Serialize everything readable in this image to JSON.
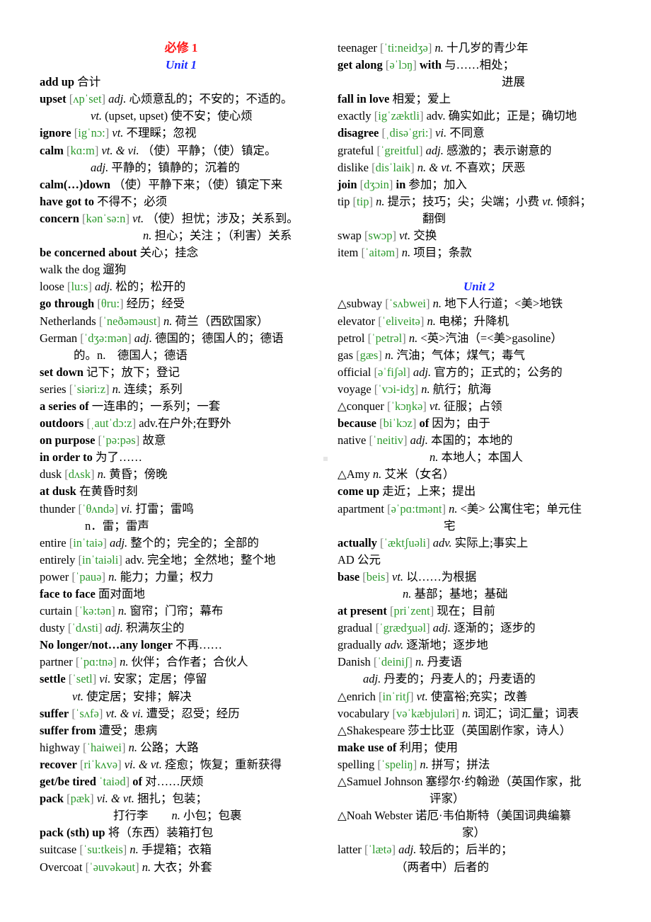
{
  "document": {
    "book_title": "必修 1",
    "units": [
      {
        "title": "Unit 1",
        "entries": [
          {
            "hw": "add up",
            "bold": true,
            "def": "合计"
          },
          {
            "hw": "upset",
            "bold": true,
            "ph": "ʌpˈset",
            "pos": "adj.",
            "def": "心烦意乱的；不安的；不适的。",
            "cont": [
              {
                "indent": 72,
                "pos": "vt.",
                "def": "(upset, upset)  使不安；使心烦"
              }
            ]
          },
          {
            "hw": "ignore",
            "bold": true,
            "ph": "igˈnɔ:",
            "pos": "vt.",
            "def": "不理睬；忽视"
          },
          {
            "hw": "calm",
            "bold": true,
            "ph": "kɑ:m",
            "pos": "vt. & vi.",
            "def": "（使）平静；（使）镇定。",
            "cont": [
              {
                "indent": 72,
                "pos": "adj.",
                "def": "平静的；镇静的；沉着的"
              }
            ]
          },
          {
            "hw": "calm(…)down",
            "bold": true,
            "def": "（使）平静下来；（使）镇定下来"
          },
          {
            "hw": "have got to",
            "bold": true,
            "def": "不得不；必须"
          },
          {
            "hw": "concern",
            "bold": true,
            "ph": "kənˈsə:n",
            "pos": "vt.",
            "def": "（使）担忧；涉及；关系到。",
            "cont": [
              {
                "indent": 146,
                "pos": "n.",
                "def": "担心；关注 ；（利害）关系"
              }
            ]
          },
          {
            "hw": "be concerned about",
            "bold": true,
            "def": "关心；挂念"
          },
          {
            "hw": "walk the dog",
            "bold": false,
            "def": "遛狗"
          },
          {
            "hw": "loose",
            "bold": false,
            "ph": "lu:s",
            "pos": "adj.",
            "def": "松的；松开的"
          },
          {
            "hw": "go through",
            "bold": true,
            "ph": "θru:",
            "def": "经历；经受"
          },
          {
            "hw": "Netherlands",
            "bold": false,
            "ph": "ˈneðəməust",
            "pos": "n.",
            "def": "荷兰（西欧国家）"
          },
          {
            "hw": "German",
            "bold": false,
            "ph": "ˈdʒə:mən",
            "pos": "adj.",
            "def": "德国的；德国人的；德语",
            "cont": [
              {
                "indent": 48,
                "pos": "",
                "def": "的。n.　德国人；德语"
              }
            ]
          },
          {
            "hw": "set down",
            "bold": true,
            "def": "记下；放下；登记"
          },
          {
            "hw": "series",
            "bold": false,
            "ph": "ˈsiəri:z",
            "pos": "n.",
            "def": "连续；系列"
          },
          {
            "hw": "a series of",
            "bold": true,
            "def": "一连串的；一系列；一套"
          },
          {
            "hw": "outdoors",
            "bold": true,
            "ph": "ˌautˈdɔ:z",
            "pos": "",
            "def": "adv.在户外;在野外"
          },
          {
            "hw": "on purpose",
            "bold": true,
            "ph": "ˈpə:pəs",
            "def": "故意"
          },
          {
            "hw": "in order to",
            "bold": true,
            "def": "为了……"
          },
          {
            "hw": "dusk",
            "bold": false,
            "ph": "dʌsk",
            "pos": "n.",
            "def": "黄昏；傍晚"
          },
          {
            "hw": "at dusk",
            "bold": true,
            "def": "在黄昏时刻"
          },
          {
            "hw": "thunder",
            "bold": false,
            "ph": "ˈθʌndə",
            "pos": "vi.",
            "def": "打雷；雷鸣",
            "cont": [
              {
                "indent": 64,
                "pos": "",
                "def": "n．雷；雷声"
              }
            ]
          },
          {
            "hw": "entire",
            "bold": false,
            "ph": "inˈtaiə",
            "pos": "adj.",
            "def": "整个的；完全的；全部的"
          },
          {
            "hw": "entirely",
            "bold": false,
            "ph": "inˈtaiəli",
            "pos": "",
            "def": "adv.  完全地；全然地；整个地"
          },
          {
            "hw": "power",
            "bold": false,
            "ph": "ˈpauə",
            "pos": "n.",
            "def": "能力；力量；权力"
          },
          {
            "hw": "face to face",
            "bold": true,
            "def": "面对面地"
          },
          {
            "hw": "curtain",
            "bold": false,
            "ph": "ˈkə:tən",
            "pos": "n.",
            "def": "窗帘；门帘；幕布"
          },
          {
            "hw": "dusty",
            "bold": false,
            "ph": "ˈdʌsti",
            "pos": "adj.",
            "def": "积满灰尘的"
          },
          {
            "hw": "No longer/not…any longer",
            "bold": true,
            "def": "不再……"
          },
          {
            "hw": "partner",
            "bold": false,
            "ph": "ˈpɑ:tnə",
            "pos": "n.",
            "def": "伙伴；合作者；合伙人"
          },
          {
            "hw": "settle",
            "bold": true,
            "ph": "ˈsetl",
            "pos": "vi.",
            "def": "安家；定居；停留",
            "cont": [
              {
                "indent": 46,
                "pos": "vt.",
                "def": "使定居；安排；解决"
              }
            ]
          },
          {
            "hw": "suffer",
            "bold": true,
            "ph": "ˈsʌfə",
            "pos": "vt. & vi.",
            "def": "遭受；忍受；经历"
          },
          {
            "hw": "suffer from",
            "bold": true,
            "def": "遭受；患病"
          },
          {
            "hw": "highway",
            "bold": false,
            "ph": "ˈhaiwei",
            "pos": "n.",
            "def": "公路；大路"
          },
          {
            "hw": "recover",
            "bold": true,
            "ph": "riˈkʌvə",
            "pos": "vi. & vt.",
            "def": "痊愈；恢复；重新获得"
          },
          {
            "hw": "get/be tired",
            "bold": true,
            "ph_open_missing": true,
            "ph": "ˈtaiəd",
            "tail": "of",
            "def": "对……厌烦"
          },
          {
            "hw": "pack",
            "bold": true,
            "ph": "pæk",
            "pos": "vi. & vt.",
            "def": "捆扎；包装；",
            "cont": [
              {
                "indent": 104,
                "pos": "",
                "def": "打行李　　",
                "pos2": "n.",
                "def2": "小包；包裹"
              }
            ]
          },
          {
            "hw": "pack (sth) up",
            "bold": true,
            "def": "将（东西）装箱打包"
          },
          {
            "hw": "suitcase",
            "bold": false,
            "ph": "ˈsu:tkeis",
            "pos": "n.",
            "def": "手提箱；衣箱"
          },
          {
            "hw": "Overcoat",
            "bold": false,
            "ph": "ˈəuvəkəut",
            "pos": "n.",
            "def": "大衣；外套"
          },
          {
            "hw": "teenager",
            "bold": false,
            "ph": "ˈti:neidʒə",
            "pos": "n.",
            "def": "十几岁的青少年"
          },
          {
            "hw": "get along",
            "bold": true,
            "ph": "əˈlɔŋ",
            "tail": "with",
            "def": "与……相处；",
            "cont": [
              {
                "indent": 232,
                "pos": "",
                "def": "进展"
              }
            ]
          },
          {
            "hw": "fall in love",
            "bold": true,
            "def": "相爱；爱上"
          },
          {
            "hw": "exactly",
            "bold": false,
            "ph": "igˈzæktli",
            "pos": "",
            "def": "adv.  确实如此；正是；确切地"
          },
          {
            "hw": "disagree",
            "bold": true,
            "ph": "ˌdisəˈgri:",
            "pos": "vi.",
            "def": "不同意"
          },
          {
            "hw": "grateful",
            "bold": false,
            "ph": "ˈgreitful",
            "pos": "adj.",
            "def": "感激的；表示谢意的"
          },
          {
            "hw": "dislike",
            "bold": false,
            "ph": "disˈlaik",
            "pos": "n. & vt.",
            "def": "不喜欢；厌恶"
          },
          {
            "hw": "join",
            "bold": true,
            "ph": "dʒɔin",
            "tail": "in",
            "def": "参加；加入"
          },
          {
            "hw": "tip",
            "bold": false,
            "ph": "tip",
            "pos": "n.",
            "def": "提示；技巧；尖；尖端；小费",
            "pos2": "vt.",
            "def2": "倾斜；",
            "cont": [
              {
                "indent": 120,
                "pos": "",
                "def": "翻倒"
              }
            ]
          },
          {
            "hw": "swap",
            "bold": false,
            "ph": "swɔp",
            "pos": "vt.",
            "def": "交换"
          },
          {
            "hw": "item",
            "bold": false,
            "ph": "ˈaitəm",
            "pos": "n.",
            "def": "项目；条款"
          }
        ]
      },
      {
        "title": "Unit 2",
        "entries": [
          {
            "hw": "△subway",
            "bold": false,
            "ph": "ˈsʌbwei",
            "pos": "n.",
            "def": "地下人行道；<美>地铁"
          },
          {
            "hw": "elevator",
            "bold": false,
            "ph": "ˈeliveitə",
            "pos": "n.",
            "def": "电梯；升降机"
          },
          {
            "hw": "petrol",
            "bold": false,
            "ph": "ˈpetrəl",
            "pos": "n.",
            "def": "<英>汽油（=<美>gasoline）"
          },
          {
            "hw": "gas",
            "bold": false,
            "ph": "gæs",
            "pos": "n.",
            "def": "汽油；气体；煤气；毒气"
          },
          {
            "hw": "official",
            "bold": false,
            "ph": "əˈfiʃəl",
            "pos": "adj.",
            "def": "官方的；正式的；公务的"
          },
          {
            "hw": "voyage",
            "bold": false,
            "ph": "ˈvɔi-idʒ",
            "pos": "n.",
            "def": "航行；航海"
          },
          {
            "hw": "△conquer",
            "bold": false,
            "ph": "ˈkɔŋkə",
            "pos": "vt.",
            "def": "征服；占领"
          },
          {
            "hw": "because",
            "bold": true,
            "ph": "biˈkɔz",
            "tail": "of",
            "def": "因为；由于"
          },
          {
            "hw": "native",
            "bold": false,
            "ph": "ˈneitiv",
            "pos": "adj.",
            "def": "本国的；本地的",
            "cont": [
              {
                "indent": 130,
                "pos": "n.",
                "def": "本地人；本国人"
              }
            ]
          },
          {
            "hw": "△Amy",
            "bold": false,
            "pos": "n.",
            "def": "艾米（女名）"
          },
          {
            "hw": "come up",
            "bold": true,
            "def": "走近；上来；提出"
          },
          {
            "hw": "apartment",
            "bold": false,
            "ph": "əˈpɑ:tmənt",
            "pos": "n.",
            "def": "<美>  公寓住宅；单元住",
            "cont": [
              {
                "indent": 150,
                "pos": "",
                "def": "宅"
              }
            ]
          },
          {
            "hw": "actually",
            "bold": true,
            "ph": "ˈæktʃuəli",
            "pos": "adv.",
            "def": "实际上;事实上"
          },
          {
            "hw": "AD",
            "bold": false,
            "def": "公元"
          },
          {
            "hw": "base",
            "bold": true,
            "ph": "beis",
            "pos": "vt.",
            "def": "以……为根据",
            "cont": [
              {
                "indent": 92,
                "pos": "n.",
                "def": "基部；基地；基础"
              }
            ]
          },
          {
            "hw": "at present",
            "bold": true,
            "ph": "priˈzent",
            "def": "现在；目前"
          },
          {
            "hw": "gradual",
            "bold": false,
            "ph": "ˈgrædʒuəl",
            "pos": "adj.",
            "def": "逐渐的；逐步的"
          },
          {
            "hw": "gradually",
            "bold": false,
            "pos": "adv.",
            "def": "逐渐地；逐步地"
          },
          {
            "hw": "Danish",
            "bold": false,
            "ph": "ˈdeiniʃ",
            "pos": "n.",
            "def": "丹麦语",
            "cont": [
              {
                "indent": 36,
                "pos": "adj.",
                "def": "丹麦的；丹麦人的；丹麦语的"
              }
            ]
          },
          {
            "hw": "△enrich",
            "bold": false,
            "ph": "inˈritʃ",
            "pos": "vt.",
            "def": "使富裕;充实；改善"
          },
          {
            "hw": "vocabulary",
            "bold": false,
            "ph": "vəˈkæbjuləri",
            "pos": "n.",
            "def": "词汇；词汇量；词表"
          },
          {
            "hw": "△Shakespeare",
            "bold": false,
            "def": "莎士比亚（英国剧作家，诗人）"
          },
          {
            "hw": "make use of",
            "bold": true,
            "def": "利用；使用"
          },
          {
            "hw": "spelling",
            "bold": false,
            "ph": "ˈspeliŋ",
            "pos": "n.",
            "def": "拼写；拼法"
          },
          {
            "hw": "△Samuel Johnson",
            "bold": false,
            "def": "塞缪尔·约翰逊（英国作家，批",
            "cont": [
              {
                "indent": 130,
                "pos": "",
                "def": "评家）"
              }
            ]
          },
          {
            "hw": "△Noah Webster",
            "bold": false,
            "def": "诺厄·韦伯斯特（美国词典编纂",
            "cont": [
              {
                "indent": 176,
                "pos": "",
                "def": "家）"
              }
            ]
          },
          {
            "hw": "latter",
            "bold": false,
            "ph": "ˈlætə",
            "pos": "adj.",
            "def": "较后的；后半的；",
            "cont": [
              {
                "indent": 82,
                "pos": "",
                "def": "（两者中）后者的"
              }
            ]
          }
        ]
      }
    ]
  }
}
